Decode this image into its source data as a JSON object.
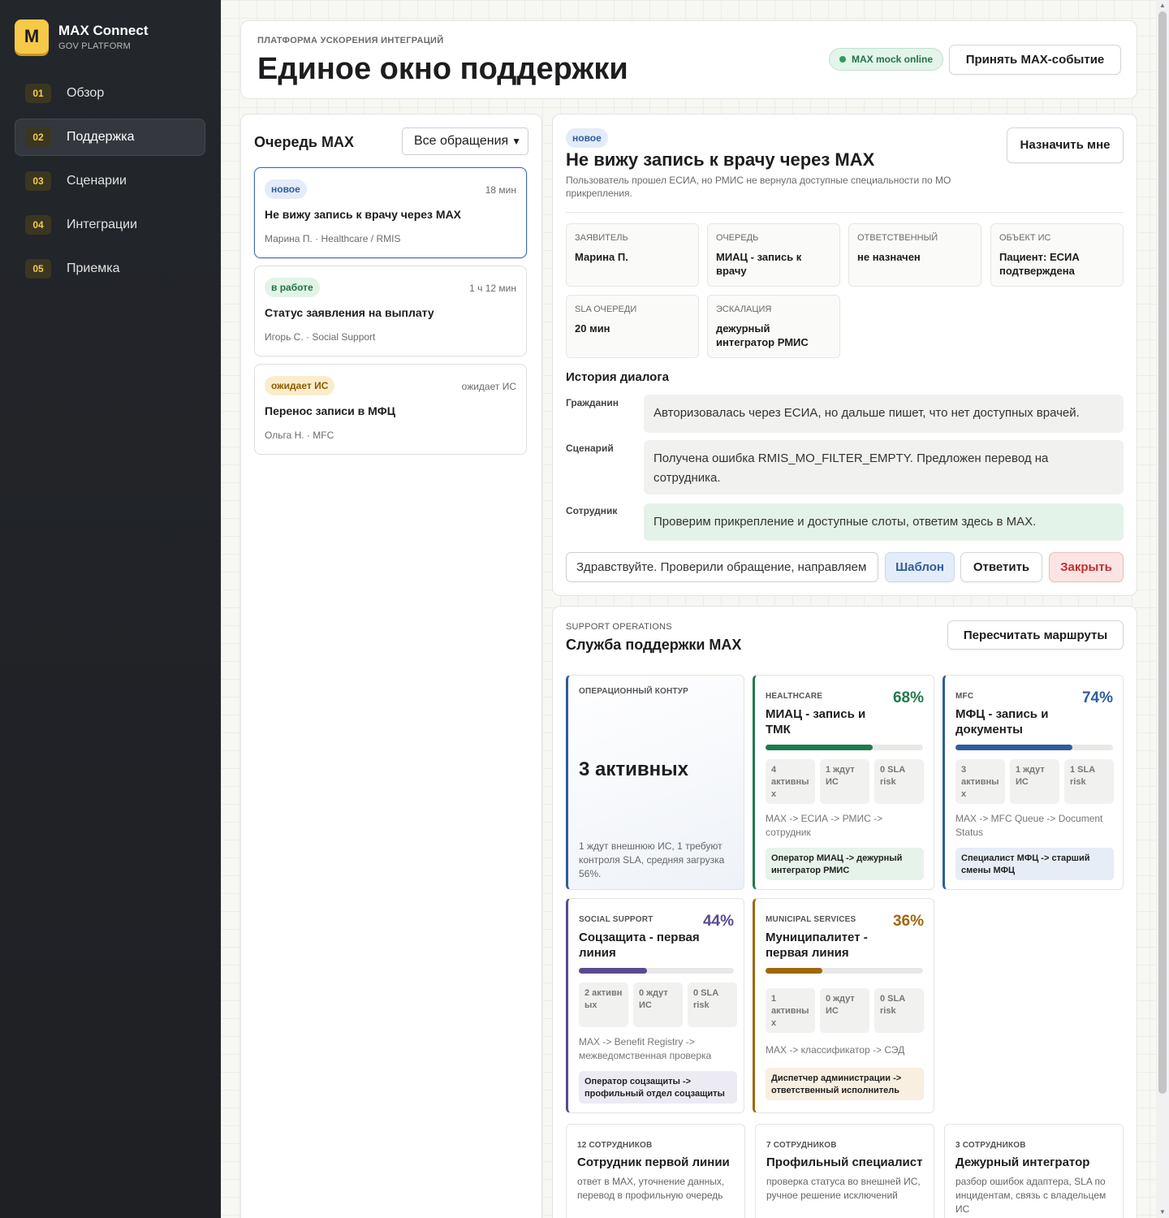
{
  "brand": {
    "logo": "M",
    "title": "MAX Connect",
    "subtitle": "GOV PLATFORM"
  },
  "nav": [
    {
      "num": "01",
      "label": "Обзор"
    },
    {
      "num": "02",
      "label": "Поддержка",
      "active": true
    },
    {
      "num": "03",
      "label": "Сценарии"
    },
    {
      "num": "04",
      "label": "Интеграции"
    },
    {
      "num": "05",
      "label": "Приемка"
    }
  ],
  "header": {
    "eyebrow": "ПЛАТФОРМА УСКОРЕНИЯ ИНТЕГРАЦИЙ",
    "title": "Единое окно поддержки",
    "status": "MAX mock online",
    "accept_button": "Принять MAX-событие"
  },
  "queue": {
    "title": "Очередь MAX",
    "filter": "Все обращения",
    "tickets": [
      {
        "badge": "новое",
        "time": "18 мин",
        "title": "Не вижу запись к врачу через MAX",
        "meta": "Марина П. · Healthcare / RMIS"
      },
      {
        "badge": "в работе",
        "time": "1 ч 12 мин",
        "title": "Статус заявления на выплату",
        "meta": "Игорь С. · Social Support"
      },
      {
        "badge": "ожидает ИС",
        "time": "ожидает ИС",
        "title": "Перенос записи в МФЦ",
        "meta": "Ольга Н. · MFC"
      }
    ]
  },
  "detail": {
    "badge": "новое",
    "title": "Не вижу запись к врачу через MAX",
    "description": "Пользователь прошел ЕСИА, но РМИС не вернула доступные специальности по МО прикрепления.",
    "assign_button": "Назначить мне",
    "fields": [
      {
        "label": "ЗАЯВИТЕЛЬ",
        "value": "Марина П."
      },
      {
        "label": "ОЧЕРЕДЬ",
        "value": "МИАЦ - запись к врачу"
      },
      {
        "label": "ОТВЕТСТВЕННЫЙ",
        "value": "не назначен"
      },
      {
        "label": "ОБЪЕКТ ИС",
        "value": "Пациент: ЕСИА подтверждена"
      },
      {
        "label": "SLA ОЧЕРЕДИ",
        "value": "20 мин"
      },
      {
        "label": "ЭСКАЛАЦИЯ",
        "value": "дежурный интегратор РМИС"
      }
    ],
    "history_title": "История диалога",
    "messages": [
      {
        "role": "Гражданин",
        "text": "Авторизовалась через ЕСИА, но дальше пишет, что нет доступных врачей."
      },
      {
        "role": "Сценарий",
        "text": "Получена ошибка RMIS_MO_FILTER_EMPTY. Предложен перевод на сотрудника."
      },
      {
        "role": "Сотрудник",
        "text": "Проверим прикрепление и доступные слоты, ответим здесь в MAX."
      }
    ],
    "reply_value": "Здравствуйте. Проверили обращение, направляем",
    "template_button": "Шаблон",
    "reply_button": "Ответить",
    "close_button": "Закрыть"
  },
  "ops": {
    "eyebrow": "SUPPORT OPERATIONS",
    "title": "Служба поддержки MAX",
    "recalc_button": "Пересчитать маршруты",
    "overview": {
      "eyebrow": "ОПЕРАЦИОННЫЙ КОНТУР",
      "big": "3 активных",
      "note": "1 ждут внешнюю ИС, 1 требуют контроля SLA, средняя загрузка 56%."
    },
    "queues": [
      {
        "tag": "HEALTHCARE",
        "pct": "68%",
        "load": 0.68,
        "color": "#1f7a4d",
        "bg": "#e6f3eb",
        "name": "МИАЦ - запись и ТМК",
        "stats": [
          "4 активны х",
          "1 ждут ИС",
          "0 SLA risk"
        ],
        "route": "MAX -> ЕСИА -> РМИС -> сотрудник",
        "assign": "Оператор МИАЦ -> дежурный интегратор РМИС"
      },
      {
        "tag": "MFC",
        "pct": "74%",
        "load": 0.74,
        "color": "#2f5d9c",
        "bg": "#e6edf7",
        "name": "МФЦ - запись и документы",
        "stats": [
          "3 активны х",
          "1 ждут ИС",
          "1 SLA risk"
        ],
        "route": "MAX -> MFC Queue -> Document Status",
        "assign": "Специалист МФЦ -> старший смены МФЦ"
      },
      {
        "tag": "SOCIAL SUPPORT",
        "pct": "44%",
        "load": 0.44,
        "color": "#5b4a8f",
        "bg": "#ecebf4",
        "name": "Соцзащита - первая линия",
        "stats": [
          "2 активн ых",
          "0 ждут ИС",
          "0 SLA risk"
        ],
        "route": "MAX -> Benefit Registry -> межведомственная проверка",
        "assign": "Оператор соцзащиты -> профильный отдел соцзащиты"
      },
      {
        "tag": "MUNICIPAL SERVICES",
        "pct": "36%",
        "load": 0.36,
        "color": "#a0670a",
        "bg": "#f8efe0",
        "name": "Муниципалитет - первая линия",
        "stats": [
          "1 активны х",
          "0 ждут ИС",
          "0 SLA risk"
        ],
        "route": "MAX -> классификатор -> СЭД",
        "assign": "Диспетчер администрации -> ответственный исполнитель"
      }
    ],
    "staff": [
      {
        "count": "12 СОТРУДНИКОВ",
        "role": "Сотрудник первой линии",
        "desc": "ответ в MAX, уточнение данных, перевод в профильную очередь"
      },
      {
        "count": "7 СОТРУДНИКОВ",
        "role": "Профильный специалист",
        "desc": "проверка статуса во внешней ИС, ручное решение исключений"
      },
      {
        "count": "3 СОТРУДНИКОВ",
        "role": "Дежурный интегратор",
        "desc": "разбор ошибок адаптера, SLA по инцидентам, связь с владельцем ИС"
      }
    ]
  }
}
